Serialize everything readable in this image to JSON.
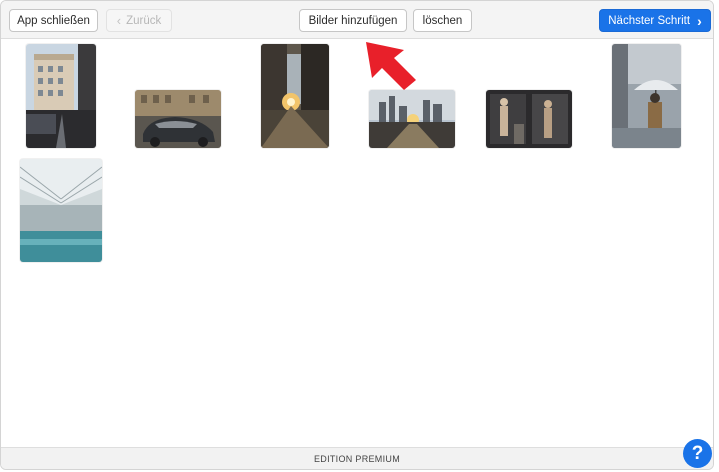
{
  "toolbar": {
    "close_label": "App schließen",
    "back_label": "Zurück",
    "add_images_label": "Bilder hinzufügen",
    "delete_label": "löschen",
    "next_label": "Nächster Schritt",
    "back_icon": "chevron-left-icon",
    "next_icon": "chevron-right-icon"
  },
  "footer": {
    "edition_label": "EDITION PREMIUM"
  },
  "help": {
    "label": "?",
    "icon": "help-icon"
  },
  "images": {
    "count": 7
  },
  "colors": {
    "accent": "#1a73e8",
    "annotation_arrow": "#e8202a"
  }
}
